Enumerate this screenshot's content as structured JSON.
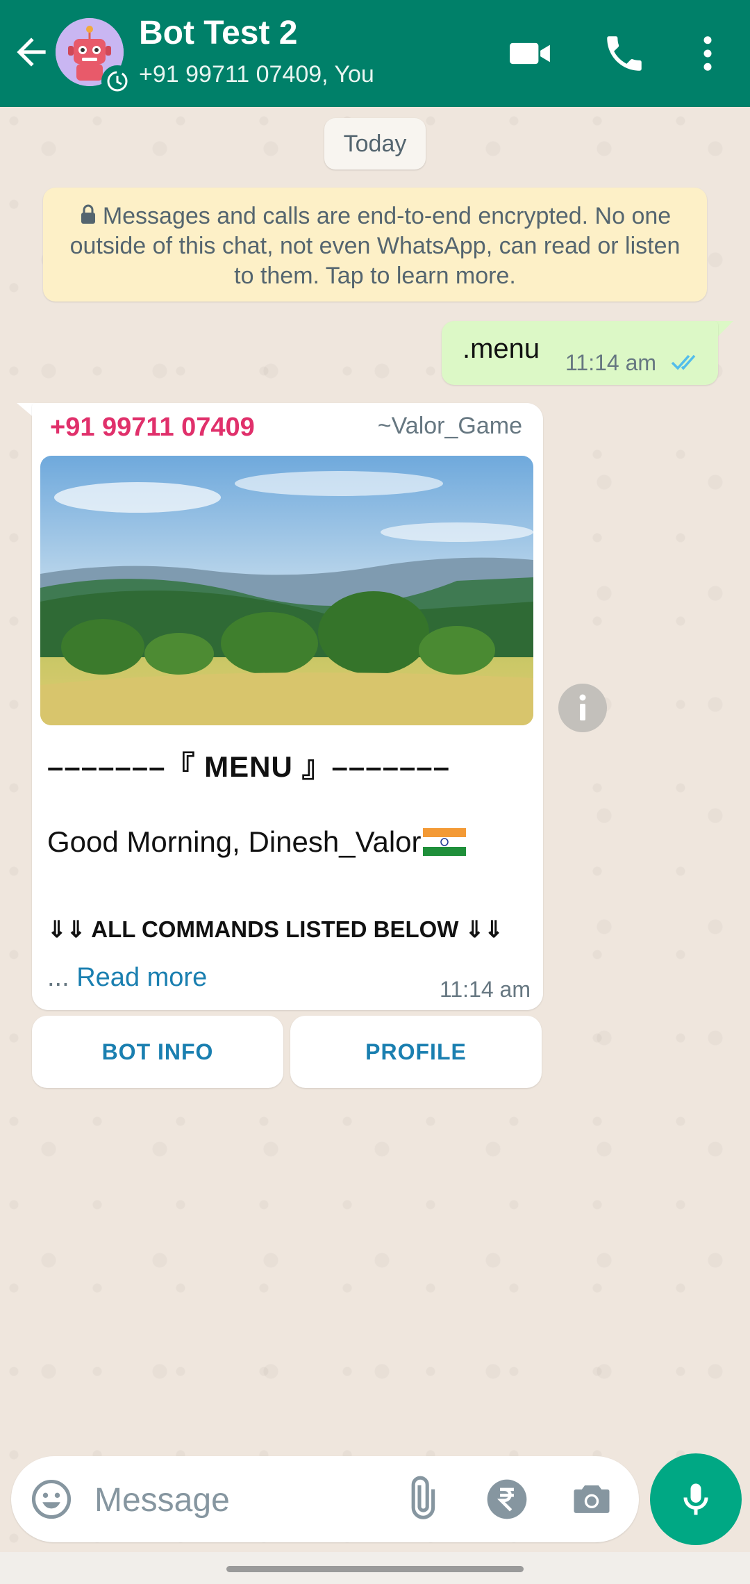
{
  "header": {
    "title": "Bot Test 2",
    "subtitle": "+91 99711 07409, You",
    "icons": [
      "back-arrow-icon",
      "video-call-icon",
      "voice-call-icon",
      "more-options-icon"
    ]
  },
  "date_chip": "Today",
  "encryption_notice": "Messages and calls are end-to-end encrypted. No one outside of this chat, not even WhatsApp, can read or listen to them. Tap to learn more.",
  "outgoing_message": {
    "text": ".menu",
    "time": "11:14 am",
    "status": "read"
  },
  "incoming_card": {
    "sender": "+91 99711 07409",
    "alias": "~Valor_Game",
    "menu_title": "–––––––『 MENU 』–––––––",
    "greeting": "Good Morning, Dinesh_Valor",
    "commands_line": "⇓⇓ ALL COMMANDS LISTED BELOW ⇓⇓",
    "ellipsis": "... ",
    "read_more": "Read more",
    "time": "11:14 am",
    "buttons": [
      "BOT INFO",
      "PROFILE"
    ]
  },
  "composer": {
    "placeholder": "Message",
    "icons": [
      "emoji-icon",
      "attach-icon",
      "rupee-payment-icon",
      "camera-icon",
      "mic-icon"
    ]
  },
  "colors": {
    "header": "#008069",
    "accent": "#00a884",
    "outgoing_bubble": "#dcf8c6",
    "sender_name": "#e0306b",
    "link": "#1a7fb0"
  }
}
